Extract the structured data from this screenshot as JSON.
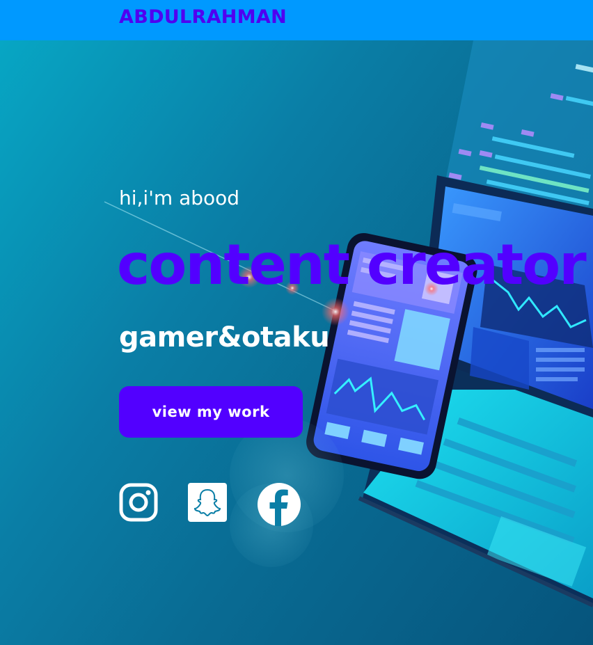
{
  "navbar": {
    "brand": "ABDULRAHMAN"
  },
  "hero": {
    "greeting": "hi,i'm abood",
    "headline": "content creator",
    "subline": "gamer&otaku",
    "cta_label": "view my work"
  },
  "social": [
    {
      "name": "instagram",
      "icon": "instagram-icon"
    },
    {
      "name": "snapchat",
      "icon": "snapchat-icon"
    },
    {
      "name": "facebook",
      "icon": "facebook-icon"
    }
  ],
  "colors": {
    "navbar": "#0099ff",
    "accent": "#5200ff",
    "hero_bg": "#0a7ea6",
    "text_light": "#ffffff"
  }
}
